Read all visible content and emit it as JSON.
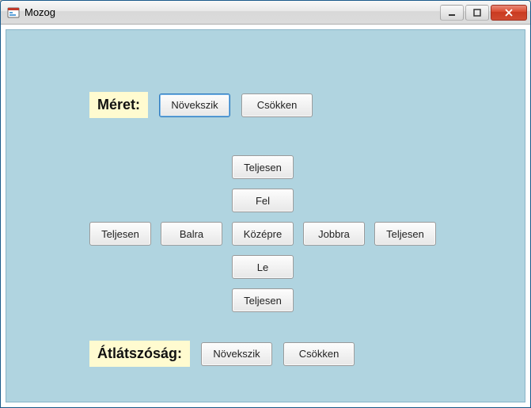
{
  "window": {
    "title": "Mozog"
  },
  "size": {
    "label": "Méret:",
    "increase": "Növekszik",
    "decrease": "Csökken"
  },
  "move": {
    "fully_up": "Teljesen",
    "up": "Fel",
    "fully_left": "Teljesen",
    "left": "Balra",
    "center": "Középre",
    "right": "Jobbra",
    "fully_right": "Teljesen",
    "down": "Le",
    "fully_down": "Teljesen"
  },
  "opacity": {
    "label": "Átlátszóság:",
    "increase": "Növekszik",
    "decrease": "Csökken"
  }
}
